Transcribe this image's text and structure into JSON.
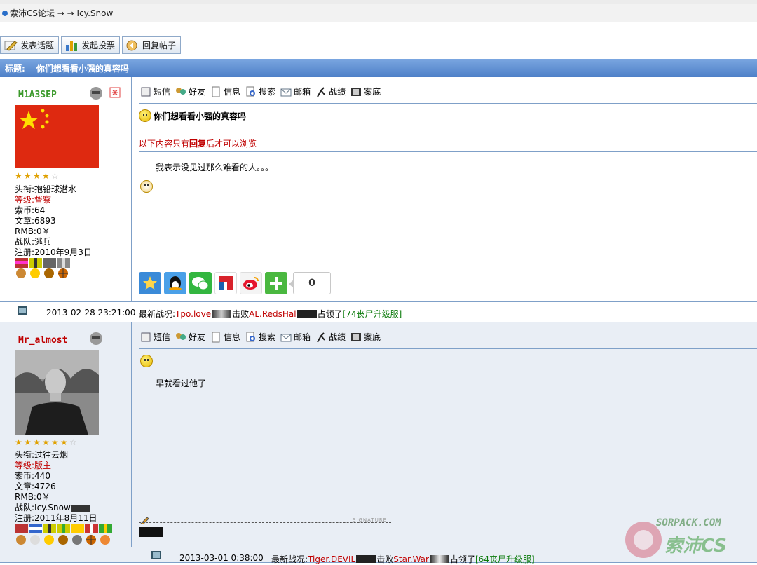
{
  "breadcrumb": {
    "text": "索沛CS论坛 → → Icy.Snow"
  },
  "toolbar": {
    "new_topic": "发表话题",
    "new_poll": "发起投票",
    "reply": "回复帖子"
  },
  "thread": {
    "title_label": "标题:",
    "title": "你们想看看小强的真容吗"
  },
  "action_labels": [
    "短信",
    "好友",
    "信息",
    "搜索",
    "邮箱",
    "战绩",
    "案底"
  ],
  "posts": [
    {
      "username": "M1A3SEP",
      "username_color": "#3c9a2c",
      "stars_on": 4,
      "stars_total": 5,
      "title_label": "头衔:",
      "title_value": "抱铅球潜水",
      "level_label": "等级:",
      "level_value": "督察",
      "coins_label": "索币:",
      "coins_value": "64",
      "articles_label": "文章:",
      "articles_value": "6893",
      "rmb_label": "RMB:",
      "rmb_value": "0￥",
      "team_label": "战队:",
      "team_value": "逃兵",
      "reg_label": "注册:",
      "reg_value": "2010年9月3日",
      "subject": "你们想看看小强的真容吗",
      "hidden_note_pre": "以下内容只有",
      "hidden_note_bold": "回复",
      "hidden_note_post": "后才可以浏览",
      "body": "我表示没见过那么难看的人。。。",
      "share_count": "0",
      "time": "2013-02-28 23:21:00",
      "news_label": "最新战况:",
      "news_p1": "Tpo.love",
      "news_mid": "击败",
      "news_p2": "AL.RedsHal",
      "news_mid2": "占领了",
      "news_server": "[74丧尸升级服]"
    },
    {
      "username": "Mr_almost",
      "username_color": "#c00000",
      "stars_on": 6,
      "stars_total": 7,
      "title_label": "头衔:",
      "title_value": "过往云烟",
      "level_label": "等级:",
      "level_value": "版主",
      "coins_label": "索币:",
      "coins_value": "440",
      "articles_label": "文章:",
      "articles_value": "4726",
      "rmb_label": "RMB:",
      "rmb_value": "0￥",
      "team_label": "战队:",
      "team_value": "Icy.Snow",
      "reg_label": "注册:",
      "reg_value": "2011年8月11日",
      "body": "早就看过他了",
      "signature_mark": "SIGNATURE",
      "time": "2013-03-01 0:38:00",
      "news_label": "最新战况:",
      "news_p1": "Tiger.DEVIL",
      "news_mid": "击败",
      "news_p2": "Star.War",
      "news_mid2": "占领了",
      "news_server": "[64丧尸升级服]"
    }
  ],
  "watermark": {
    "line1": "SORPACK.COM",
    "line2": "索沛CS"
  },
  "colors": {
    "title_bar": "#5b8bd0",
    "border": "#7fa0c8",
    "alt_row": "#e9eef5",
    "accent_red": "#c00000"
  }
}
